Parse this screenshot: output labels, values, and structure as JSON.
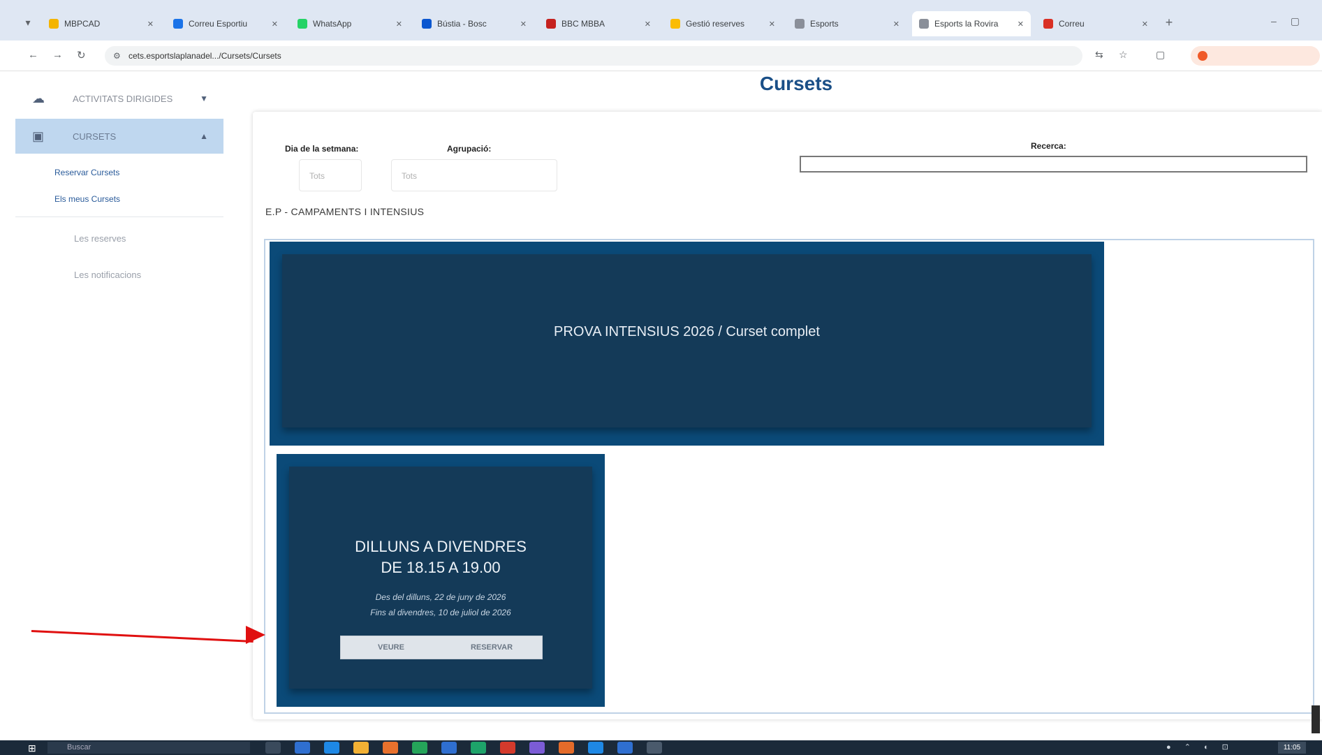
{
  "browser": {
    "tabs": [
      {
        "title": "MBPCAD",
        "color": "#f4b400"
      },
      {
        "title": "Correu Esportiu",
        "color": "#1a73e8"
      },
      {
        "title": "WhatsApp",
        "color": "#25d366"
      },
      {
        "title": "Bústia - Bosc",
        "color": "#0b57d0"
      },
      {
        "title": "BBC MBBA",
        "color": "#c5221f"
      },
      {
        "title": "Gestió reserves",
        "color": "#fbbc04"
      },
      {
        "title": "Esports",
        "color": "#8a8f99"
      },
      {
        "title": "Esports la Rovira",
        "color": "#8a8f99"
      },
      {
        "title": "Correu",
        "color": "#d93025"
      }
    ],
    "url": "cets.esportslaplanadel.../Cursets/Cursets"
  },
  "sidebar": {
    "section1": "ACTIVITATS DIRIGIDES",
    "section2": "CURSETS",
    "sub_links": [
      "Reservar Cursets",
      "Els meus Cursets"
    ],
    "plain_items": [
      "Les reserves",
      "Les notificacions"
    ]
  },
  "page": {
    "title": "Cursets",
    "filters": {
      "day_label": "Dia de la setmana:",
      "day_value": "Tots",
      "group_label": "Agrupació:",
      "group_value": "Tots",
      "search_label": "Recerca:"
    },
    "group_heading": "E.P - CAMPAMENTS I INTENSIUS",
    "big_card": {
      "title": "PROVA INTENSIUS 2026 / Curset complet"
    },
    "small_card": {
      "title_line1": "DILLUNS A DIVENDRES",
      "title_line2": "DE 18.15 A 19.00",
      "date_start": "Des del dilluns, 22 de juny de 2026",
      "date_end": "Fins al divendres, 10 de juliol de 2026",
      "btn_left": "VEURE",
      "btn_right": "RESERVAR"
    }
  },
  "taskbar": {
    "search_placeholder": "Buscar",
    "clock": "11:05"
  }
}
